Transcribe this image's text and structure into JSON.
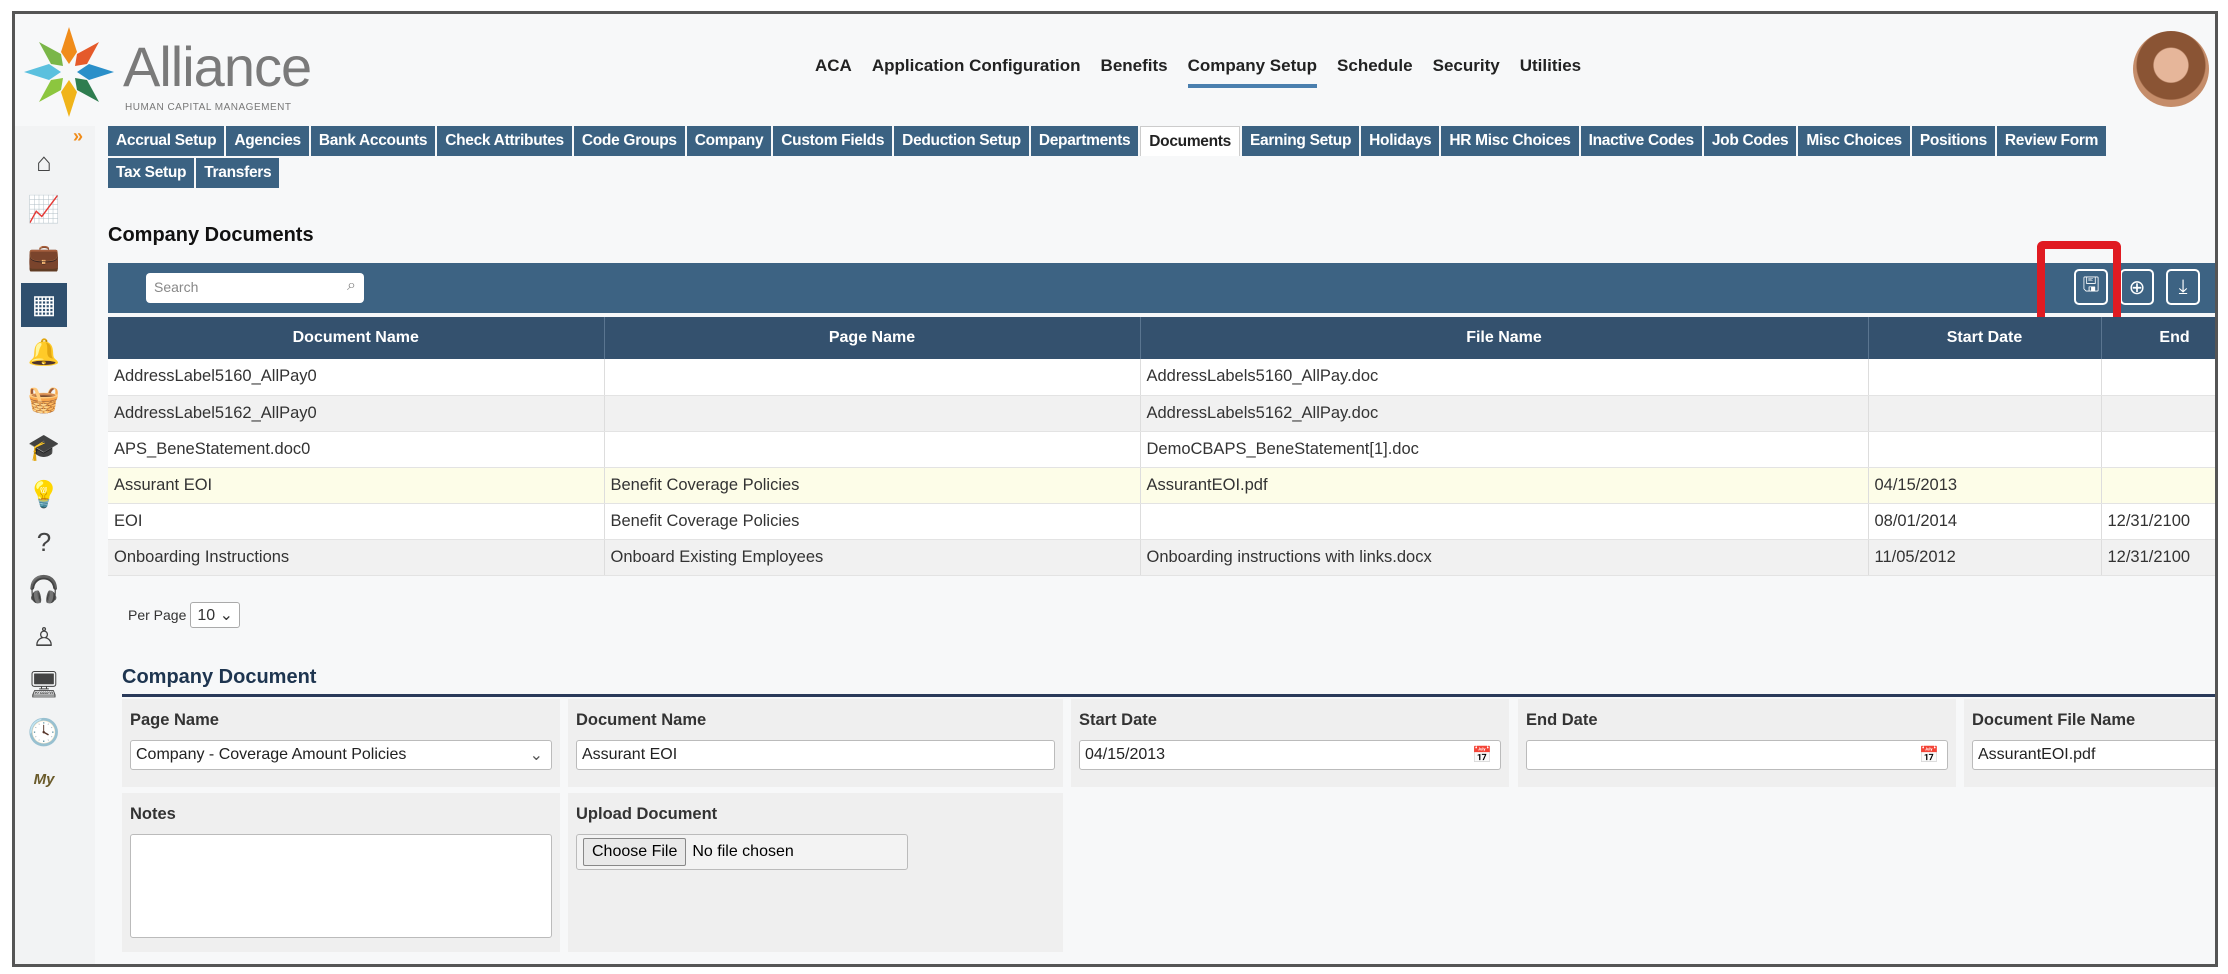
{
  "brand": {
    "name": "Alliance",
    "tagline": "HUMAN CAPITAL MANAGEMENT"
  },
  "topnav": [
    "ACA",
    "Application Configuration",
    "Benefits",
    "Company Setup",
    "Schedule",
    "Security",
    "Utilities"
  ],
  "topnav_active": "Company Setup",
  "sidebar": [
    "home-icon",
    "analytics-icon",
    "briefcase-icon",
    "building-icon",
    "bell-icon",
    "basket-icon",
    "graduation-cap-icon",
    "lightbulb-icon",
    "help-icon",
    "headset-icon",
    "person-icon",
    "monitor-icon",
    "clock-icon",
    "mypay-icon"
  ],
  "sidebar_icons": [
    "⌂",
    "📈",
    "💼",
    "▦",
    "🔔",
    "🧺",
    "🎓",
    "💡",
    "?",
    "🎧",
    "♙",
    "🖥",
    "🕓",
    "My"
  ],
  "tabs_row1": [
    "Accrual Setup",
    "Agencies",
    "Bank Accounts",
    "Check Attributes",
    "Code Groups",
    "Company",
    "Custom Fields",
    "Deduction Setup",
    "Departments",
    "Documents",
    "Earning Setup",
    "Holidays",
    "HR Misc Choices",
    "Inactive Codes",
    "Job Codes",
    "Misc Choices",
    "Positions",
    "Review Form"
  ],
  "tabs_row2": [
    "Tax Setup",
    "Transfers"
  ],
  "active_tab": "Documents",
  "list": {
    "title": "Company Documents",
    "search_placeholder": "Search",
    "columns": [
      "Document Name",
      "Page Name",
      "File Name",
      "Start Date",
      "End"
    ],
    "rows": [
      [
        "AddressLabel5160_AllPay0",
        "",
        "AddressLabels5160_AllPay.doc",
        "",
        ""
      ],
      [
        "AddressLabel5162_AllPay0",
        "",
        "AddressLabels5162_AllPay.doc",
        "",
        ""
      ],
      [
        "APS_BeneStatement.doc0",
        "",
        "DemoCBAPS_BeneStatement[1].doc",
        "",
        ""
      ],
      [
        "Assurant EOI",
        "Benefit Coverage Policies",
        "AssurantEOI.pdf",
        "04/15/2013",
        ""
      ],
      [
        "EOI",
        "Benefit Coverage Policies",
        "",
        "08/01/2014",
        "12/31/2100"
      ],
      [
        "Onboarding Instructions",
        "Onboard Existing Employees",
        "Onboarding instructions with links.docx",
        "11/05/2012",
        "12/31/2100"
      ]
    ],
    "selected_row": 3,
    "per_page_label": "Per Page",
    "per_page": "10"
  },
  "form": {
    "title": "Company Document",
    "page_name_label": "Page Name",
    "page_name": "Company - Coverage Amount Policies",
    "document_name_label": "Document Name",
    "document_name": "Assurant EOI",
    "start_date_label": "Start Date",
    "start_date": "04/15/2013",
    "end_date_label": "End Date",
    "end_date": "",
    "file_name_label": "Document File Name",
    "file_name": "AssurantEOI.pdf",
    "notes_label": "Notes",
    "notes": "",
    "upload_label": "Upload Document",
    "choose_file": "Choose File",
    "no_file": "No file chosen"
  },
  "colors": {
    "tab": "#3b6282",
    "toolbar": "#3d6383",
    "header": "#34516e",
    "highlight": "#e01b22",
    "selected_row": "#fdfde8"
  }
}
